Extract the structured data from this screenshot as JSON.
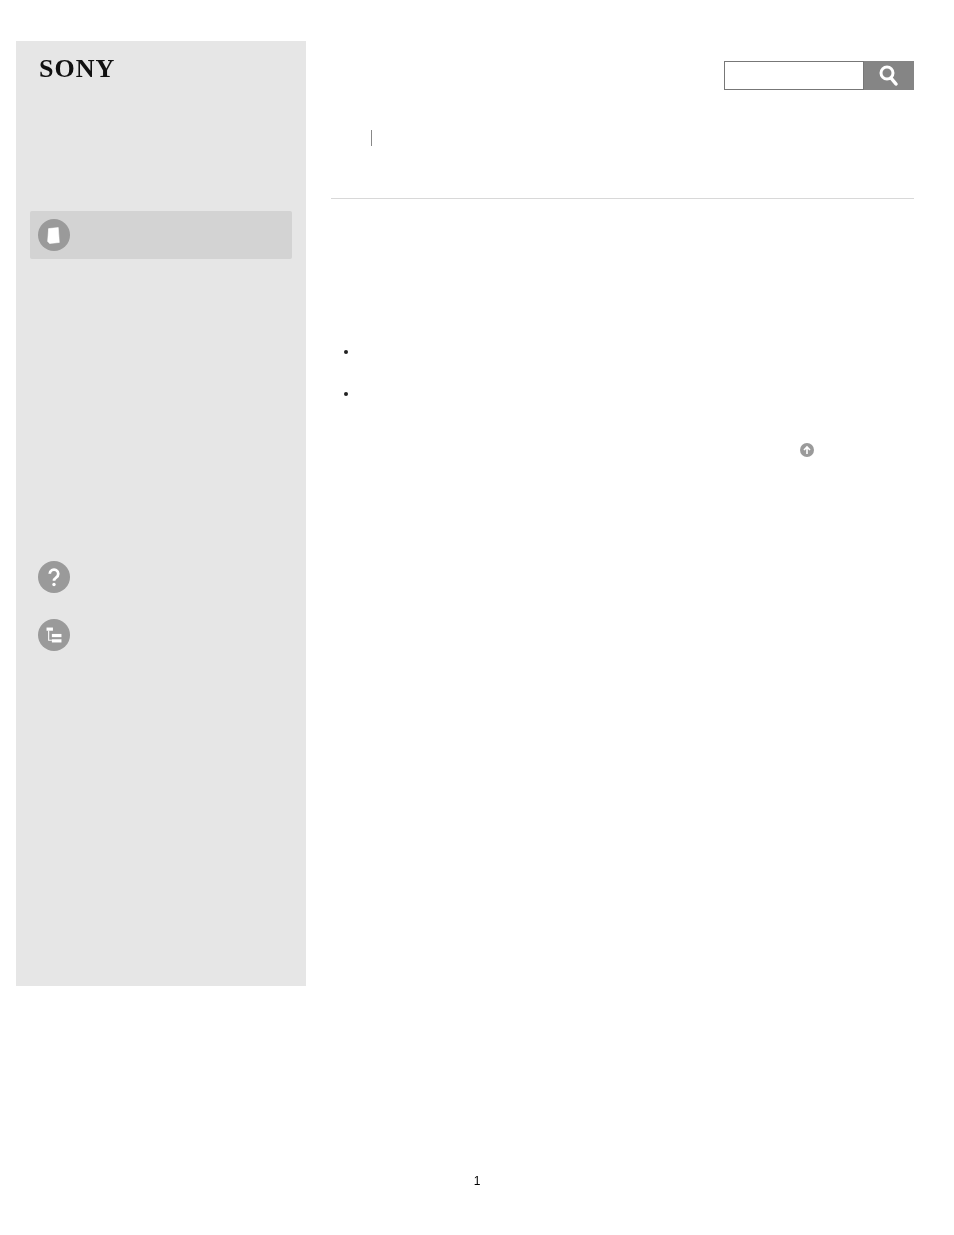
{
  "logo": "SONY",
  "sidebar": {
    "items": [
      {
        "kind": "manual",
        "selected": true
      },
      {
        "kind": "help",
        "selected": false
      },
      {
        "kind": "contents",
        "selected": false
      }
    ]
  },
  "page_number": "1"
}
